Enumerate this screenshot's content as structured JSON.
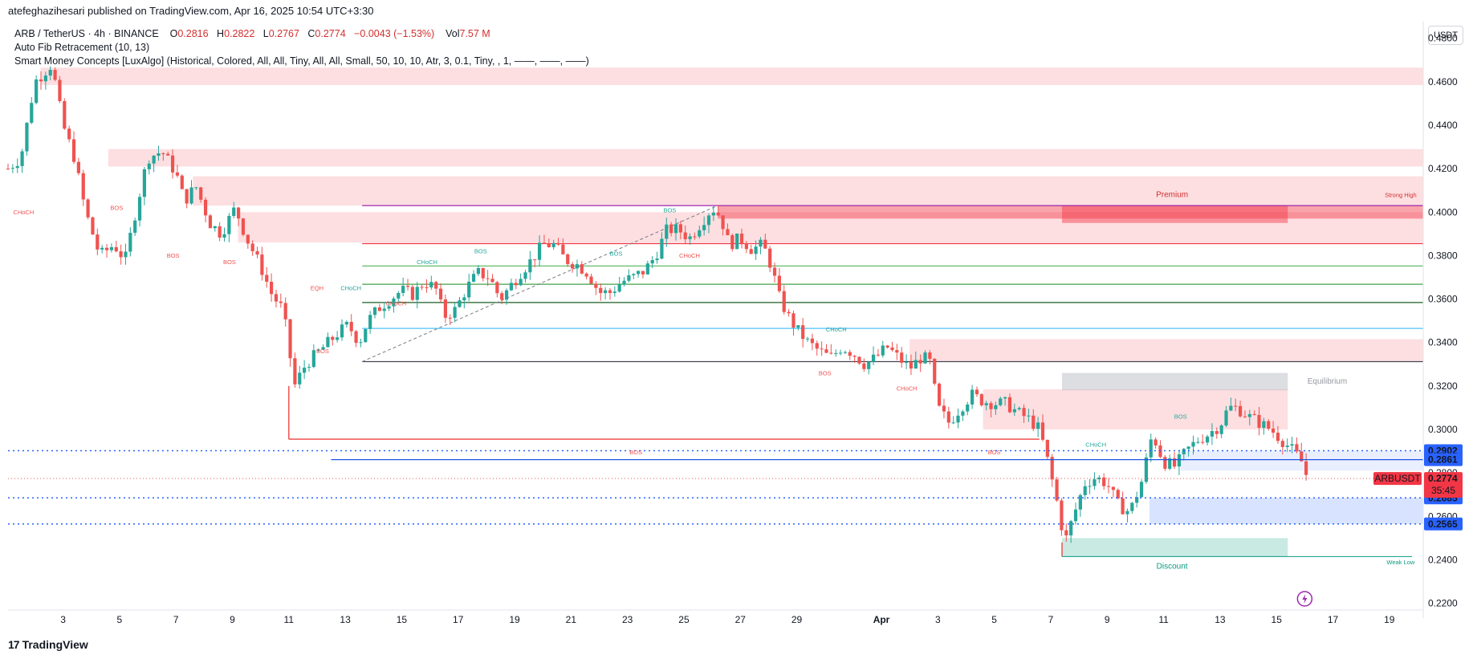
{
  "header": {
    "publisher": "atefeghazihesari published on TradingView.com, Apr 16, 2025 10:54 UTC+3:30"
  },
  "legend": {
    "symbol": "ARB / TetherUS · 4h · BINANCE",
    "o_label": "O",
    "o_value": "0.2816",
    "h_label": "H",
    "h_value": "0.2822",
    "l_label": "L",
    "l_value": "0.2767",
    "c_label": "C",
    "c_value": "0.2774",
    "change": "−0.0043 (−1.53%)",
    "vol_label": "Vol",
    "vol_value": "7.57 M",
    "indicator_1": "Auto Fib Retracement (10, 13)",
    "indicator_2": "Smart Money Concepts [LuxAlgo] (Historical, Colored, All, All, Tiny, All, All, Small, 50, 10, 10, Atr, 3, 0.1, Tiny, , 1, ——, ——, ——)"
  },
  "currency_button": "USDT",
  "footer": {
    "logo_mark": "17",
    "logo_text": "TradingView"
  },
  "colors": {
    "up": "#26a69a",
    "down": "#ef5350",
    "premium": "#f7c5c5",
    "discount": "#b2dfdb",
    "equilibrium": "#d1d4dc",
    "blue": "#2962ff"
  },
  "chart_data": {
    "type": "candlestick",
    "symbol": "ARBUSDT",
    "timeframe": "4h",
    "y_ticks": [
      0.22,
      0.24,
      0.26,
      0.28,
      0.3,
      0.32,
      0.34,
      0.36,
      0.38,
      0.4,
      0.42,
      0.44,
      0.46,
      0.48
    ],
    "y_tick_labels": [
      "0.2200",
      "0.2400",
      "0.2600",
      "0.2800",
      "0.3000",
      "0.3200",
      "0.3400",
      "0.3600",
      "0.3800",
      "0.4000",
      "0.4200",
      "0.4400",
      "0.4600",
      "0.4800"
    ],
    "ylim": [
      0.218,
      0.488
    ],
    "x_ticks": [
      {
        "label": "3",
        "day": 3
      },
      {
        "label": "5",
        "day": 5
      },
      {
        "label": "7",
        "day": 7
      },
      {
        "label": "9",
        "day": 9
      },
      {
        "label": "11",
        "day": 11
      },
      {
        "label": "13",
        "day": 13
      },
      {
        "label": "15",
        "day": 15
      },
      {
        "label": "17",
        "day": 17
      },
      {
        "label": "19",
        "day": 19
      },
      {
        "label": "21",
        "day": 21
      },
      {
        "label": "23",
        "day": 23
      },
      {
        "label": "25",
        "day": 25
      },
      {
        "label": "27",
        "day": 27
      },
      {
        "label": "29",
        "day": 29
      },
      {
        "label": "Apr",
        "day": 32,
        "bold": true
      },
      {
        "label": "3",
        "day": 34
      },
      {
        "label": "5",
        "day": 36
      },
      {
        "label": "7",
        "day": 38
      },
      {
        "label": "9",
        "day": 40
      },
      {
        "label": "11",
        "day": 42
      },
      {
        "label": "13",
        "day": 44
      },
      {
        "label": "15",
        "day": 46
      },
      {
        "label": "17",
        "day": 48
      },
      {
        "label": "19",
        "day": 50
      }
    ],
    "xlim_days": [
      1.05,
      51.2
    ],
    "path_points": [
      [
        1.05,
        0.42
      ],
      [
        1.5,
        0.425
      ],
      [
        2.0,
        0.46
      ],
      [
        2.6,
        0.468
      ],
      [
        3.0,
        0.44
      ],
      [
        3.4,
        0.425
      ],
      [
        3.8,
        0.4
      ],
      [
        4.3,
        0.38
      ],
      [
        4.8,
        0.385
      ],
      [
        5.2,
        0.378
      ],
      [
        5.6,
        0.402
      ],
      [
        6.0,
        0.425
      ],
      [
        6.5,
        0.428
      ],
      [
        7.0,
        0.418
      ],
      [
        7.3,
        0.405
      ],
      [
        7.7,
        0.412
      ],
      [
        8.2,
        0.395
      ],
      [
        8.6,
        0.39
      ],
      [
        9.1,
        0.402
      ],
      [
        9.5,
        0.388
      ],
      [
        10.0,
        0.375
      ],
      [
        10.4,
        0.362
      ],
      [
        10.8,
        0.355
      ],
      [
        11.2,
        0.32
      ],
      [
        11.6,
        0.33
      ],
      [
        12.0,
        0.335
      ],
      [
        12.4,
        0.34
      ],
      [
        12.8,
        0.345
      ],
      [
        13.1,
        0.348
      ],
      [
        13.5,
        0.34
      ],
      [
        13.8,
        0.35
      ],
      [
        14.2,
        0.356
      ],
      [
        14.6,
        0.36
      ],
      [
        15.0,
        0.364
      ],
      [
        15.4,
        0.362
      ],
      [
        15.8,
        0.368
      ],
      [
        16.2,
        0.365
      ],
      [
        16.5,
        0.352
      ],
      [
        16.9,
        0.355
      ],
      [
        17.3,
        0.365
      ],
      [
        17.7,
        0.372
      ],
      [
        18.1,
        0.37
      ],
      [
        18.5,
        0.36
      ],
      [
        18.8,
        0.365
      ],
      [
        19.2,
        0.372
      ],
      [
        19.6,
        0.378
      ],
      [
        20.0,
        0.385
      ],
      [
        20.4,
        0.385
      ],
      [
        20.8,
        0.378
      ],
      [
        21.2,
        0.376
      ],
      [
        21.6,
        0.372
      ],
      [
        22.0,
        0.363
      ],
      [
        22.4,
        0.363
      ],
      [
        22.8,
        0.368
      ],
      [
        23.2,
        0.37
      ],
      [
        23.6,
        0.373
      ],
      [
        24.0,
        0.38
      ],
      [
        24.4,
        0.392
      ],
      [
        24.8,
        0.392
      ],
      [
        25.2,
        0.388
      ],
      [
        25.6,
        0.395
      ],
      [
        26.0,
        0.402
      ],
      [
        26.3,
        0.398
      ],
      [
        26.6,
        0.385
      ],
      [
        27.0,
        0.388
      ],
      [
        27.4,
        0.383
      ],
      [
        27.8,
        0.385
      ],
      [
        28.1,
        0.375
      ],
      [
        28.4,
        0.36
      ],
      [
        28.7,
        0.352
      ],
      [
        29.0,
        0.346
      ],
      [
        29.4,
        0.34
      ],
      [
        29.8,
        0.336
      ],
      [
        30.2,
        0.333
      ],
      [
        30.6,
        0.338
      ],
      [
        31.0,
        0.335
      ],
      [
        31.4,
        0.33
      ],
      [
        31.8,
        0.333
      ],
      [
        32.2,
        0.338
      ],
      [
        32.6,
        0.333
      ],
      [
        33.0,
        0.328
      ],
      [
        33.4,
        0.333
      ],
      [
        33.7,
        0.332
      ],
      [
        34.0,
        0.31
      ],
      [
        34.4,
        0.303
      ],
      [
        34.8,
        0.31
      ],
      [
        35.2,
        0.316
      ],
      [
        35.6,
        0.313
      ],
      [
        36.0,
        0.312
      ],
      [
        36.4,
        0.312
      ],
      [
        36.8,
        0.308
      ],
      [
        37.2,
        0.305
      ],
      [
        37.6,
        0.3
      ],
      [
        37.9,
        0.285
      ],
      [
        38.2,
        0.268
      ],
      [
        38.5,
        0.248
      ],
      [
        38.8,
        0.26
      ],
      [
        39.2,
        0.275
      ],
      [
        39.6,
        0.278
      ],
      [
        40.0,
        0.275
      ],
      [
        40.4,
        0.265
      ],
      [
        40.8,
        0.262
      ],
      [
        41.2,
        0.275
      ],
      [
        41.6,
        0.298
      ],
      [
        42.0,
        0.285
      ],
      [
        42.4,
        0.283
      ],
      [
        42.8,
        0.29
      ],
      [
        43.2,
        0.295
      ],
      [
        43.6,
        0.298
      ],
      [
        44.0,
        0.302
      ],
      [
        44.3,
        0.31
      ],
      [
        44.6,
        0.31
      ],
      [
        45.0,
        0.306
      ],
      [
        45.4,
        0.303
      ],
      [
        45.8,
        0.3
      ],
      [
        46.2,
        0.295
      ],
      [
        46.6,
        0.29
      ],
      [
        46.9,
        0.285
      ],
      [
        47.1,
        0.2774
      ]
    ],
    "fib_levels": [
      {
        "value": 0.403,
        "color": "#9c27b0"
      },
      {
        "value": 0.3855,
        "color": "#f23645"
      },
      {
        "value": 0.3752,
        "color": "#66bb6a"
      },
      {
        "value": 0.3668,
        "color": "#43a047"
      },
      {
        "value": 0.3584,
        "color": "#1b5e20"
      },
      {
        "value": 0.3465,
        "color": "#4fc3f7"
      },
      {
        "value": 0.3312,
        "color": "#434651"
      }
    ],
    "zones": [
      {
        "from_day": 2.2,
        "to_day": 51.2,
        "top": 0.4665,
        "bottom": 0.4585,
        "kind": "premium"
      },
      {
        "from_day": 4.6,
        "to_day": 51.2,
        "top": 0.429,
        "bottom": 0.421,
        "kind": "premium"
      },
      {
        "from_day": 7.6,
        "to_day": 51.2,
        "top": 0.4165,
        "bottom": 0.403,
        "kind": "premium"
      },
      {
        "from_day": 9.2,
        "to_day": 51.2,
        "top": 0.4,
        "bottom": 0.386,
        "kind": "premium"
      },
      {
        "from_day": 26.2,
        "to_day": 51.2,
        "top": 0.403,
        "bottom": 0.397,
        "kind": "premium-strong"
      },
      {
        "from_day": 33.0,
        "to_day": 51.2,
        "top": 0.3415,
        "bottom": 0.3315,
        "kind": "premium"
      },
      {
        "from_day": 35.6,
        "to_day": 46.4,
        "top": 0.3185,
        "bottom": 0.3,
        "kind": "premium"
      },
      {
        "from_day": 38.4,
        "to_day": 46.4,
        "top": 0.403,
        "bottom": 0.395,
        "kind": "premium-strong"
      },
      {
        "from_day": 38.4,
        "to_day": 46.4,
        "top": 0.326,
        "bottom": 0.318,
        "kind": "equilibrium"
      },
      {
        "from_day": 38.4,
        "to_day": 46.4,
        "top": 0.25,
        "bottom": 0.2415,
        "kind": "discount"
      },
      {
        "from_day": 41.5,
        "to_day": 51.2,
        "top": 0.2685,
        "bottom": 0.2565,
        "kind": "blue-zone"
      },
      {
        "from_day": 42.6,
        "to_day": 51.2,
        "top": 0.2902,
        "bottom": 0.281,
        "kind": "blue-zone-light"
      }
    ],
    "dotted_levels": [
      {
        "value": 0.2902,
        "label": "0.2902"
      },
      {
        "value": 0.2685,
        "label": "0.2685"
      },
      {
        "value": 0.2565,
        "label": "0.2565"
      }
    ],
    "solid_levels": [
      {
        "value": 0.2861,
        "label": "0.2861",
        "from_day": 12.5
      }
    ],
    "last_price": {
      "value": 0.2774,
      "label": "0.2774",
      "symbol": "ARBUSDT",
      "countdown": "35:45"
    },
    "annotations": [
      {
        "text": "CHoCH",
        "day": 1.6,
        "price": 0.399,
        "color": "#ef5350"
      },
      {
        "text": "BOS",
        "day": 4.9,
        "price": 0.401,
        "color": "#ef5350"
      },
      {
        "text": "BOS",
        "day": 6.9,
        "price": 0.379,
        "color": "#ef5350"
      },
      {
        "text": "BOS",
        "day": 8.9,
        "price": 0.376,
        "color": "#ef5350"
      },
      {
        "text": "EQH",
        "day": 12.0,
        "price": 0.364,
        "color": "#ef5350"
      },
      {
        "text": "BOS",
        "day": 12.2,
        "price": 0.335,
        "color": "#ef5350"
      },
      {
        "text": "CHoCH",
        "day": 13.2,
        "price": 0.364,
        "color": "#26a69a"
      },
      {
        "text": "CHoCH",
        "day": 14.8,
        "price": 0.357,
        "color": "#ef5350"
      },
      {
        "text": "CHoCH",
        "day": 15.9,
        "price": 0.376,
        "color": "#26a69a"
      },
      {
        "text": "BOS",
        "day": 17.8,
        "price": 0.381,
        "color": "#26a69a"
      },
      {
        "text": "BOS",
        "day": 22.6,
        "price": 0.38,
        "color": "#26a69a"
      },
      {
        "text": "BOS",
        "day": 24.5,
        "price": 0.4,
        "color": "#26a69a"
      },
      {
        "text": "CHoCH",
        "day": 25.2,
        "price": 0.379,
        "color": "#ef5350"
      },
      {
        "text": "CHoCH",
        "day": 30.4,
        "price": 0.345,
        "color": "#26a69a"
      },
      {
        "text": "BOS",
        "day": 30.0,
        "price": 0.325,
        "color": "#ef5350"
      },
      {
        "text": "CHoCH",
        "day": 32.9,
        "price": 0.318,
        "color": "#ef5350"
      },
      {
        "text": "BOS",
        "day": 23.3,
        "price": 0.2885,
        "color": "#ef5350"
      },
      {
        "text": "BOS",
        "day": 36.0,
        "price": 0.2885,
        "color": "#ef5350"
      },
      {
        "text": "BOS",
        "day": 42.6,
        "price": 0.305,
        "color": "#26a69a"
      },
      {
        "text": "CHoCH",
        "day": 39.6,
        "price": 0.292,
        "color": "#26a69a"
      },
      {
        "text": "Premium",
        "day": 42.3,
        "price": 0.407,
        "color": "#d32f2f",
        "zone": true
      },
      {
        "text": "Strong High",
        "day": 50.4,
        "price": 0.407,
        "color": "#d32f2f"
      },
      {
        "text": "Equilibrium",
        "day": 47.8,
        "price": 0.321,
        "color": "#9598a1",
        "zone": true
      },
      {
        "text": "Discount",
        "day": 42.3,
        "price": 0.236,
        "color": "#089981",
        "zone": true
      },
      {
        "text": "Weak Low",
        "day": 50.4,
        "price": 0.238,
        "color": "#089981"
      }
    ]
  }
}
